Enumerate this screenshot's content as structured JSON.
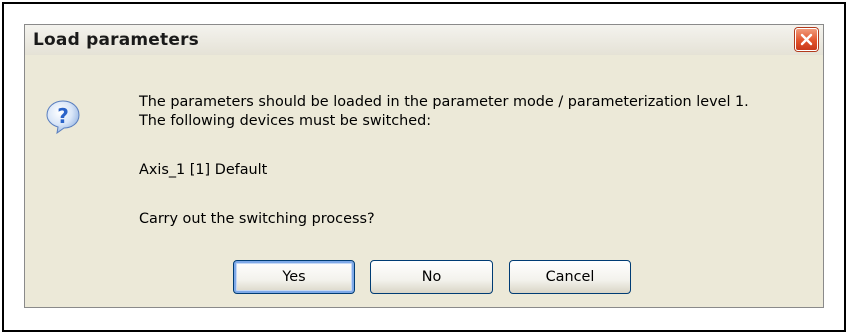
{
  "dialog": {
    "title": "Load parameters",
    "close_icon": "close-icon",
    "question_icon": "question-icon",
    "line1": "The parameters should be loaded in the parameter mode / parameterization level 1.",
    "line2": "The following devices must be switched:",
    "device": "Axis_1 [1] Default",
    "prompt": "Carry out the switching process?"
  },
  "buttons": {
    "yes": "Yes",
    "no": "No",
    "cancel": "Cancel"
  },
  "colors": {
    "dialog_background": "#ece9d8",
    "close_button": "#e2552d",
    "button_border": "#003c74",
    "question_icon_blue": "#2a63c9"
  }
}
